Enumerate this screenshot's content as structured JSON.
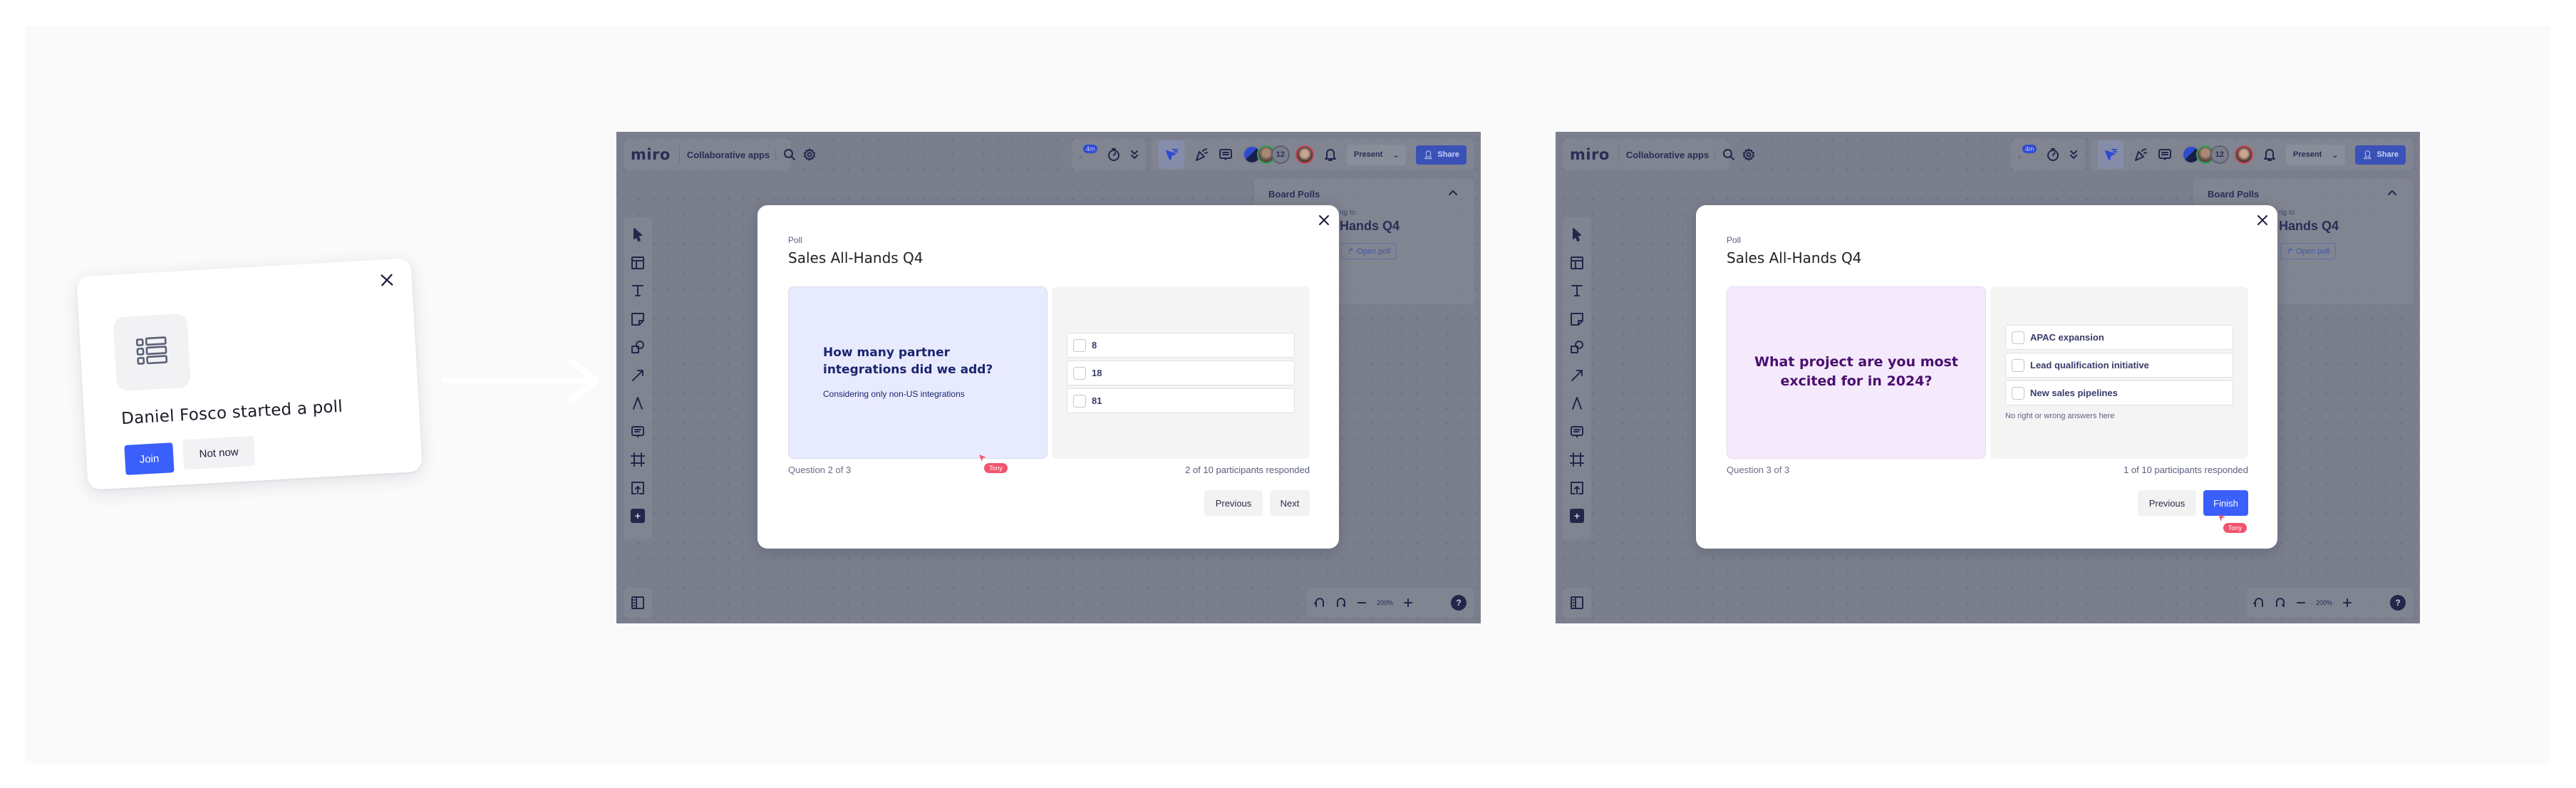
{
  "join_popup": {
    "message": "Daniel Fosco started a poll",
    "join_label": "Join",
    "not_now_label": "Not now",
    "icon": "poll-list-icon",
    "colors": {
      "primary": "#3a5ffb"
    }
  },
  "windows": [
    {
      "app": "miro",
      "board_name": "Collaborative apps",
      "timer_badge": "4m",
      "participant_count": "12",
      "present_label": "Present",
      "share_label": "Share",
      "zoom_level": "200%",
      "help_label": "?",
      "side_panel": {
        "title": "Board Polls",
        "subtitle": "ng to",
        "poll_name": "Hands Q4",
        "open_poll_label": "Open poll"
      },
      "dialog": {
        "kicker": "Poll",
        "title": "Sales All-Hands Q4",
        "question": "How many partner integrations did we add?",
        "question_sub": "Considering only non-US integrations",
        "options": [
          "8",
          "18",
          "81"
        ],
        "hint": "",
        "question_count": "Question 2 of 3",
        "responses": "2 of 10 participants responded",
        "previous_label": "Previous",
        "next_label": "Next",
        "cursor_name": "Tony"
      }
    },
    {
      "app": "miro",
      "board_name": "Collaborative apps",
      "timer_badge": "4m",
      "participant_count": "12",
      "present_label": "Present",
      "share_label": "Share",
      "zoom_level": "200%",
      "help_label": "?",
      "side_panel": {
        "title": "Board Polls",
        "subtitle": "ng to",
        "poll_name": "Hands Q4",
        "open_poll_label": "Open poll"
      },
      "dialog": {
        "kicker": "Poll",
        "title": "Sales All-Hands Q4",
        "question": "What project are you most excited for in 2024?",
        "options": [
          "APAC expansion",
          "Lead qualification initiative",
          "New sales pipelines"
        ],
        "hint": "No right or wrong answers here",
        "question_count": "Question 3 of 3",
        "responses": "1 of 10 participants responded",
        "previous_label": "Previous",
        "finish_label": "Finish",
        "cursor_name": "Tony"
      }
    }
  ]
}
